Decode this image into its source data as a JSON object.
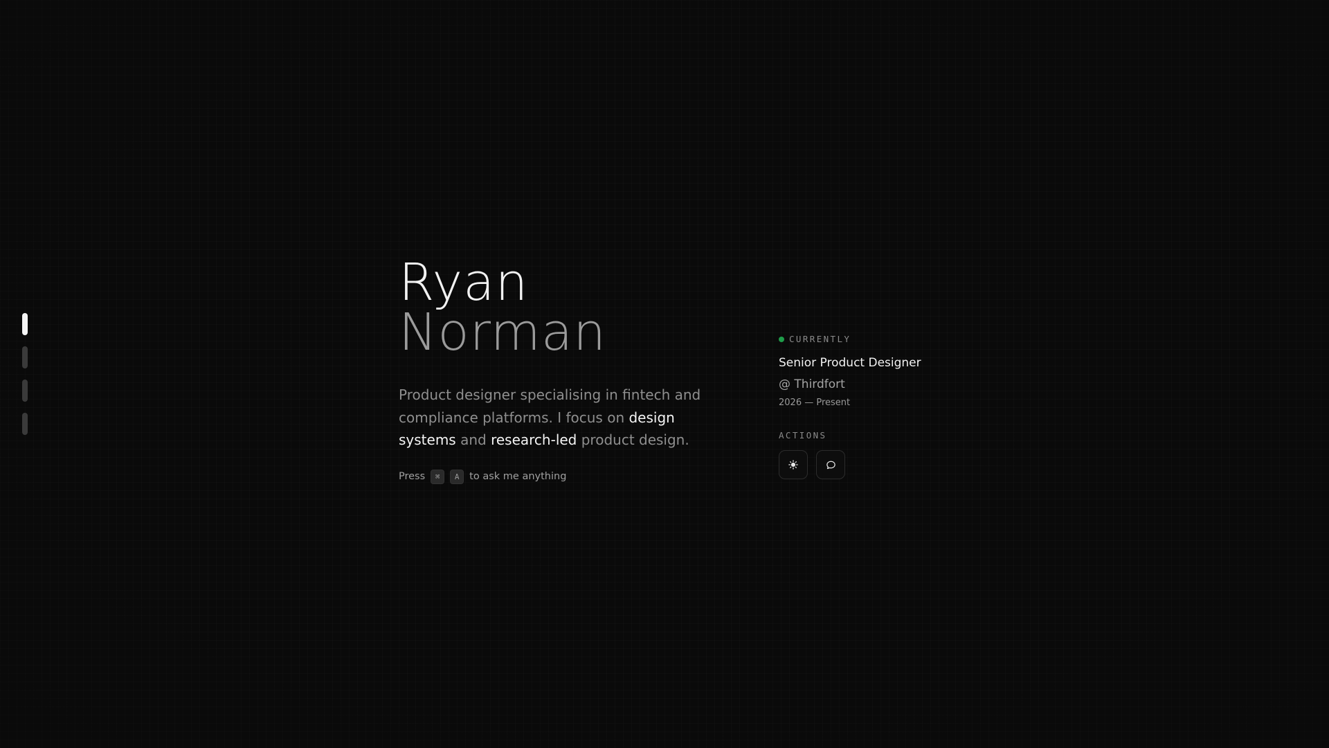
{
  "section_nav": {
    "items": [
      {
        "name": "section-1",
        "active": true
      },
      {
        "name": "section-2",
        "active": false
      },
      {
        "name": "section-3",
        "active": false
      },
      {
        "name": "section-4",
        "active": false
      }
    ]
  },
  "hero": {
    "first_name": "Ryan",
    "last_name": "Norman",
    "bio": {
      "part1": "Product designer specialising in fintech and compliance platforms. I focus on ",
      "highlight1": "design systems",
      "part2": " and ",
      "highlight2": "research-led",
      "part3": " product design."
    },
    "ask": {
      "prefix": "Press",
      "key1": "⌘",
      "key2": "A",
      "suffix": "to ask me anything"
    }
  },
  "current": {
    "label": "CURRENTLY",
    "status_color": "#1f9d4a",
    "role": "Senior Product Designer",
    "company": "@ Thirdfort",
    "dates": "2026 — Present"
  },
  "actions": {
    "label": "ACTIONS",
    "buttons": [
      {
        "icon": "sun-icon",
        "purpose": "toggle-theme"
      },
      {
        "icon": "chat-bubble-icon",
        "purpose": "open-chat"
      }
    ]
  },
  "colors": {
    "background": "#0a0a0a",
    "accent_green": "#1f9d4a"
  }
}
